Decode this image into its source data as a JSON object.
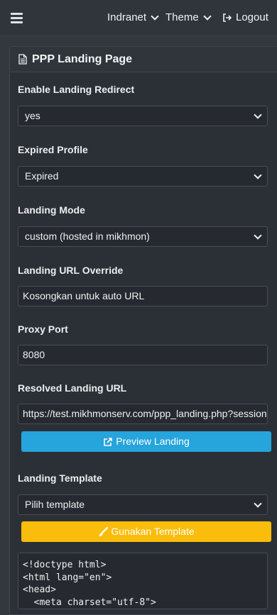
{
  "topbar": {
    "menu_items": [
      {
        "label": "Indranet"
      },
      {
        "label": "Theme"
      }
    ],
    "logout_label": "Logout"
  },
  "card": {
    "title": "PPP Landing Page"
  },
  "form": {
    "enable_redirect": {
      "label": "Enable Landing Redirect",
      "value": "yes"
    },
    "expired_profile": {
      "label": "Expired Profile",
      "value": "Expired"
    },
    "landing_mode": {
      "label": "Landing Mode",
      "value": "custom (hosted in mikhmon)"
    },
    "url_override": {
      "label": "Landing URL Override",
      "value": "Kosongkan untuk auto URL"
    },
    "proxy_port": {
      "label": "Proxy Port",
      "value": "8080"
    },
    "resolved_url": {
      "label": "Resolved Landing URL",
      "value": "https://test.mikhmonserv.com/ppp_landing.php?session="
    },
    "preview_button": "Preview Landing",
    "landing_template": {
      "label": "Landing Template",
      "value": "Pilih template"
    },
    "use_template_button": "Gunakan Template",
    "code_lines": [
      "<!doctype html>",
      "<html lang=\"en\">",
      "<head>",
      "  <meta charset=\"utf-8\">"
    ]
  },
  "colors": {
    "preview_button": "#26a4dc",
    "template_button": "#fbbd0b",
    "background": "#33383f"
  }
}
